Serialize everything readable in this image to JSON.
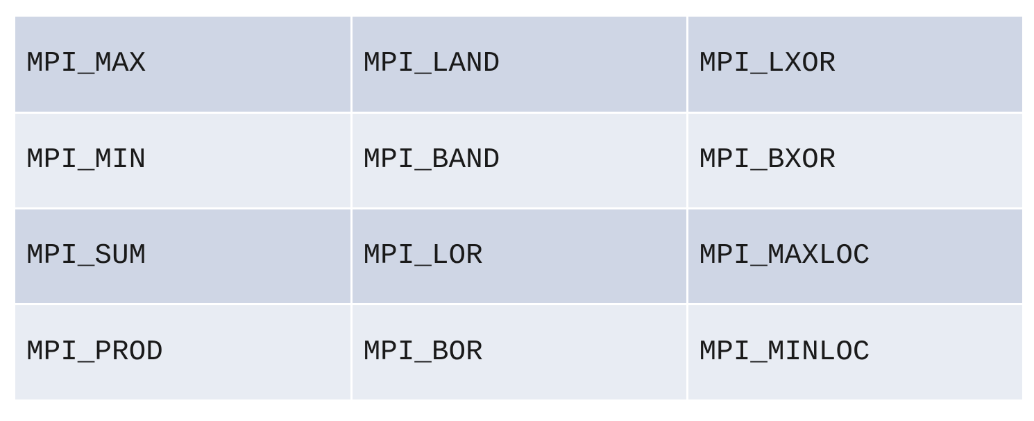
{
  "table": {
    "rows": [
      [
        "MPI_MAX",
        "MPI_LAND",
        "MPI_LXOR"
      ],
      [
        "MPI_MIN",
        "MPI_BAND",
        "MPI_BXOR"
      ],
      [
        "MPI_SUM",
        "MPI_LOR",
        "MPI_MAXLOC"
      ],
      [
        "MPI_PROD",
        "MPI_BOR",
        "MPI_MINLOC"
      ]
    ]
  },
  "colors": {
    "band_dark": "#cfd6e5",
    "band_light": "#e8ecf3",
    "text": "#1a1a1a"
  }
}
